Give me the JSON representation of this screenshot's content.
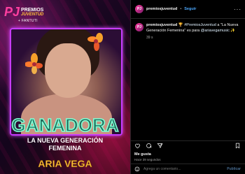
{
  "post": {
    "brand": {
      "pj": "PJ",
      "premios": "PREMIOS",
      "juventud": "JUVENTUD",
      "sponsor": "+ FANTUTI"
    },
    "banner": {
      "title": "GANADORA",
      "subtitle_line1": "LA NUEVA GENERACIÓN",
      "subtitle_line2": "FEMENINA",
      "name": "ARIA VEGA"
    },
    "colors": {
      "frame": "#c83cff",
      "title": "#7fffd4",
      "name": "#ffc23c"
    }
  },
  "header": {
    "username": "premiosjuventud",
    "dot": "•",
    "follow": "Seguir",
    "more": "···",
    "avatar": "PJ"
  },
  "caption": {
    "username": "premiosjuventud",
    "text_part1": " 🏆",
    "mention1": "#PremiosJuventud",
    "text_part2": " a \"La Nueva Generación Femenina\" es para ",
    "mention2": "@ariavegamusic",
    "text_part3": " ✨",
    "time": "39 s"
  },
  "actions": {
    "icons": [
      "heart-icon",
      "comment-icon",
      "share-icon",
      "save-icon"
    ]
  },
  "likes": "Me gusta",
  "posted": "Hace 39 segundos",
  "comment": {
    "placeholder": "Agrega un comentario...",
    "publish": "Publicar"
  }
}
